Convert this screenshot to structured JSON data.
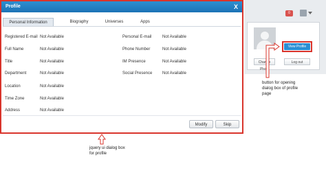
{
  "dialog": {
    "title": "Profile",
    "close_label": "X",
    "tabs": [
      {
        "label": "Personal Information"
      },
      {
        "label": "Biography"
      },
      {
        "label": "Universes"
      },
      {
        "label": "Apps"
      }
    ],
    "left_fields": [
      {
        "label": "Registered E-mail",
        "value": "Not Available"
      },
      {
        "label": "Full Name",
        "value": "Not Available"
      },
      {
        "label": "Title",
        "value": "Not Available"
      },
      {
        "label": "Department",
        "value": "Not Available"
      },
      {
        "label": "Location",
        "value": "Not Available"
      },
      {
        "label": "Time Zone",
        "value": "Not Available"
      },
      {
        "label": "Address",
        "value": "Not Available"
      }
    ],
    "right_fields": [
      {
        "label": "Personal E-mail",
        "value": "Not Available"
      },
      {
        "label": "Phone Number",
        "value": "Not Available"
      },
      {
        "label": "IM Presence",
        "value": "Not Available"
      },
      {
        "label": "Social Presence",
        "value": "Not Available"
      }
    ],
    "buttons": {
      "modify": "Modify",
      "skip": "Skip"
    }
  },
  "header": {
    "notification_count": "0"
  },
  "profile_popup": {
    "view_profile": "View Profile",
    "change_photo": "Change Photo",
    "logout": "Log out"
  },
  "annotations": {
    "dialog_caption": [
      "jquery ui dialog box",
      "for profile"
    ],
    "button_caption": [
      "button for opening",
      "dialog box of profile",
      "page"
    ]
  },
  "colors": {
    "title_bar": "#1c73b6",
    "highlight": "#d9342b",
    "view_button": "#2a8fd4",
    "badge": "#d9534f"
  }
}
